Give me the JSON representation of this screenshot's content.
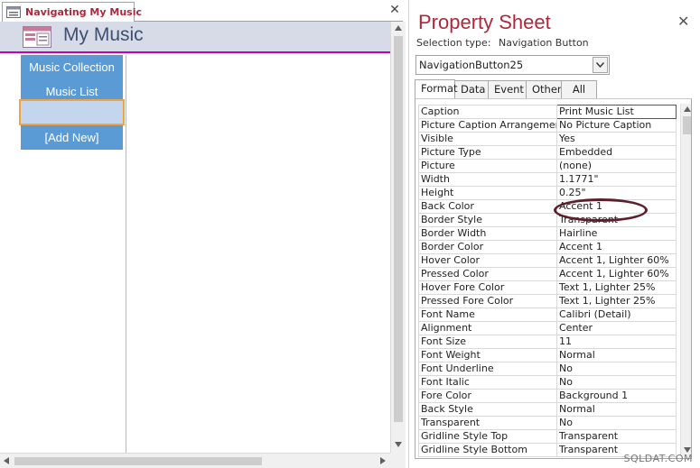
{
  "document": {
    "tab_title": "Navigating My Music",
    "close_symbol": "✕",
    "form_title": "My Music",
    "nav_buttons": [
      {
        "label": "Music Collection"
      },
      {
        "label": "Music List"
      },
      {
        "label": ""
      },
      {
        "label": "[Add New]"
      }
    ],
    "icons": [
      "form-icon",
      "close-icon",
      "navigation-form-icon"
    ]
  },
  "property_sheet": {
    "title": "Property Sheet",
    "close_symbol": "✕",
    "selection_label": "Selection type:",
    "selection_type": "Navigation Button",
    "selected_object": "NavigationButton25",
    "tabs": [
      {
        "label": "Format",
        "active": true
      },
      {
        "label": "Data",
        "active": false
      },
      {
        "label": "Event",
        "active": false
      },
      {
        "label": "Other",
        "active": false
      },
      {
        "label": "All",
        "active": false
      }
    ],
    "properties": [
      {
        "name": "Caption",
        "value": "Print Music List"
      },
      {
        "name": "Picture Caption Arrangement",
        "value": "No Picture Caption"
      },
      {
        "name": "Visible",
        "value": "Yes"
      },
      {
        "name": "Picture Type",
        "value": "Embedded"
      },
      {
        "name": "Picture",
        "value": "(none)"
      },
      {
        "name": "Width",
        "value": "1.1771\""
      },
      {
        "name": "Height",
        "value": "0.25\""
      },
      {
        "name": "Back Color",
        "value": "Accent 1"
      },
      {
        "name": "Border Style",
        "value": "Transparent"
      },
      {
        "name": "Border Width",
        "value": "Hairline"
      },
      {
        "name": "Border Color",
        "value": "Accent 1"
      },
      {
        "name": "Hover Color",
        "value": "Accent 1, Lighter 60%"
      },
      {
        "name": "Pressed Color",
        "value": "Accent 1, Lighter 60%"
      },
      {
        "name": "Hover Fore Color",
        "value": "Text 1, Lighter 25%"
      },
      {
        "name": "Pressed Fore Color",
        "value": "Text 1, Lighter 25%"
      },
      {
        "name": "Font Name",
        "value": "Calibri (Detail)"
      },
      {
        "name": "Alignment",
        "value": "Center"
      },
      {
        "name": "Font Size",
        "value": "11"
      },
      {
        "name": "Font Weight",
        "value": "Normal"
      },
      {
        "name": "Font Underline",
        "value": "No"
      },
      {
        "name": "Font Italic",
        "value": "No"
      },
      {
        "name": "Fore Color",
        "value": "Background 1"
      },
      {
        "name": "Back Style",
        "value": "Normal"
      },
      {
        "name": "Transparent",
        "value": "No"
      },
      {
        "name": "Gridline Style Top",
        "value": "Transparent"
      },
      {
        "name": "Gridline Style Bottom",
        "value": "Transparent"
      }
    ]
  },
  "watermark": "SQLDAT.COM",
  "colors": {
    "accent_title": "#b0263a",
    "nav_button": "#5b9bd5",
    "header_band": "#d6dbe7",
    "header_line": "#c000c0",
    "selection_outline": "#f4a13f",
    "annotation_ring": "#5e1f2c"
  }
}
